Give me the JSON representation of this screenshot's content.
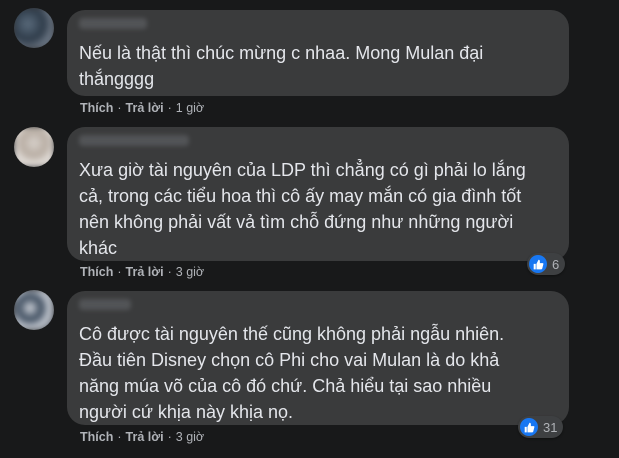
{
  "comments": [
    {
      "text": "Nếu là thật thì chúc mừng c nhaa. Mong Mulan đại\nthắngggg",
      "actions": {
        "like": "Thích",
        "reply": "Trả lời",
        "time": "1 giờ"
      },
      "reactions": null
    },
    {
      "text": "Xưa giờ tài nguyên của LDP thì chẳng có gì phải lo lắng\ncả, trong các tiểu hoa thì cô ấy may mắn có gia đình tốt\nnên không phải vất vả tìm chỗ đứng như những người\nkhác",
      "actions": {
        "like": "Thích",
        "reply": "Trả lời",
        "time": "3 giờ"
      },
      "reactions": {
        "icon": "like-icon",
        "count": "6"
      }
    },
    {
      "text": "Cô được tài nguyên thế cũng không phải ngẫu nhiên.\nĐầu tiên Disney chọn cô Phi cho vai Mulan là do khả\nnăng múa võ của cô đó chứ. Chả hiểu tại sao nhiều\nngười cứ khịa này khịa nọ.",
      "actions": {
        "like": "Thích",
        "reply": "Trả lời",
        "time": "3 giờ"
      },
      "reactions": {
        "icon": "like-icon",
        "count": "31"
      }
    }
  ],
  "separator": "·",
  "colors": {
    "background": "#18191a",
    "bubble": "#3a3b3c",
    "text": "#e4e6eb",
    "secondary": "#b0b3b8",
    "like_blue": "#1877f2"
  }
}
